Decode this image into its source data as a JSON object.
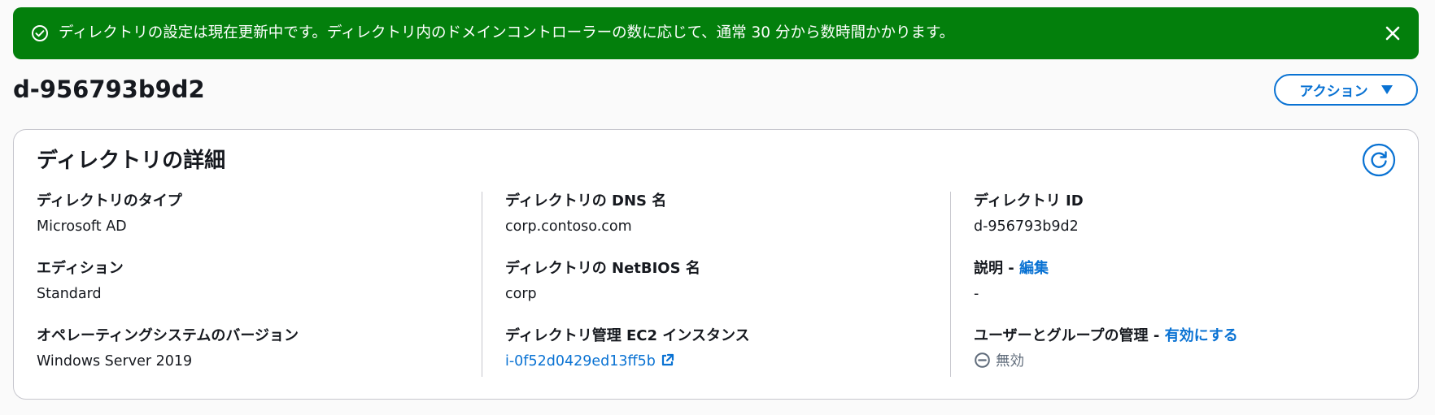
{
  "banner": {
    "message": "ディレクトリの設定は現在更新中です。ディレクトリ内のドメインコントローラーの数に応じて、通常 30 分から数時間かかります。",
    "color": "#037f0c",
    "icon": "success-check-circle-icon",
    "close_icon": "close-icon"
  },
  "page": {
    "title": "d-956793b9d2",
    "action_label": "アクション"
  },
  "panel": {
    "title": "ディレクトリの詳細",
    "refresh_icon": "refresh-icon",
    "columns": [
      {
        "fields": [
          {
            "label": "ディレクトリのタイプ",
            "value": "Microsoft AD"
          },
          {
            "label": "エディション",
            "value": "Standard"
          },
          {
            "label": "オペレーティングシステムのバージョン",
            "value": "Windows Server 2019"
          }
        ]
      },
      {
        "fields": [
          {
            "label": "ディレクトリの DNS 名",
            "value": "corp.contoso.com"
          },
          {
            "label": "ディレクトリの NetBIOS 名",
            "value": "corp"
          },
          {
            "label": "ディレクトリ管理 EC2 インスタンス",
            "value": "i-0f52d0429ed13ff5b",
            "icon": "external-link-icon"
          }
        ]
      },
      {
        "fields": [
          {
            "label": "ディレクトリ ID",
            "value": "d-956793b9d2"
          },
          {
            "label": "説明",
            "label_separator": " - ",
            "label_link": "編集",
            "value": "-"
          },
          {
            "label": "ユーザーとグループの管理",
            "label_separator": " - ",
            "label_link": "有効にする",
            "value": "無効",
            "icon": "disabled-status-icon"
          }
        ]
      }
    ]
  },
  "colors": {
    "accent": "#0972d3",
    "success": "#037f0c",
    "text": "#16191f",
    "muted": "#5f6b7a"
  }
}
